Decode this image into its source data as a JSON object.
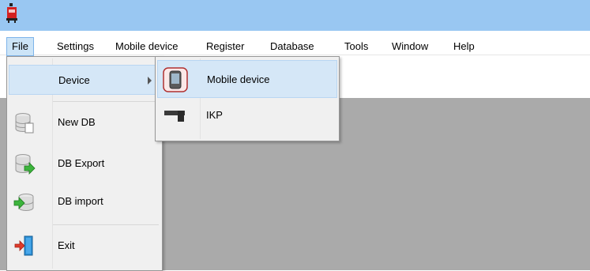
{
  "menubar": {
    "items": [
      {
        "label": "File",
        "active": true
      },
      {
        "label": "Settings"
      },
      {
        "label": "Mobile device"
      },
      {
        "label": "Register"
      },
      {
        "label": "Database"
      },
      {
        "label": "Tools"
      },
      {
        "label": "Window"
      },
      {
        "label": "Help"
      }
    ]
  },
  "file_menu": {
    "items": [
      {
        "label": "Device",
        "icon": "none",
        "has_submenu": true,
        "highlighted": true
      },
      {
        "label": "New DB",
        "icon": "database-new-icon"
      },
      {
        "label": "DB Export",
        "icon": "database-export-icon"
      },
      {
        "label": "DB import",
        "icon": "database-import-icon"
      },
      {
        "label": "Exit",
        "icon": "exit-door-icon"
      }
    ]
  },
  "device_submenu": {
    "items": [
      {
        "label": "Mobile device",
        "icon": "mobile-device-icon",
        "highlighted": true
      },
      {
        "label": "IKP",
        "icon": "ikp-scanner-icon"
      }
    ]
  },
  "colors": {
    "titlebar": "#99c7f2",
    "mdi_background": "#aaaaaa",
    "menu_background": "#f0f0f0",
    "highlight": "#d5e7f7"
  }
}
